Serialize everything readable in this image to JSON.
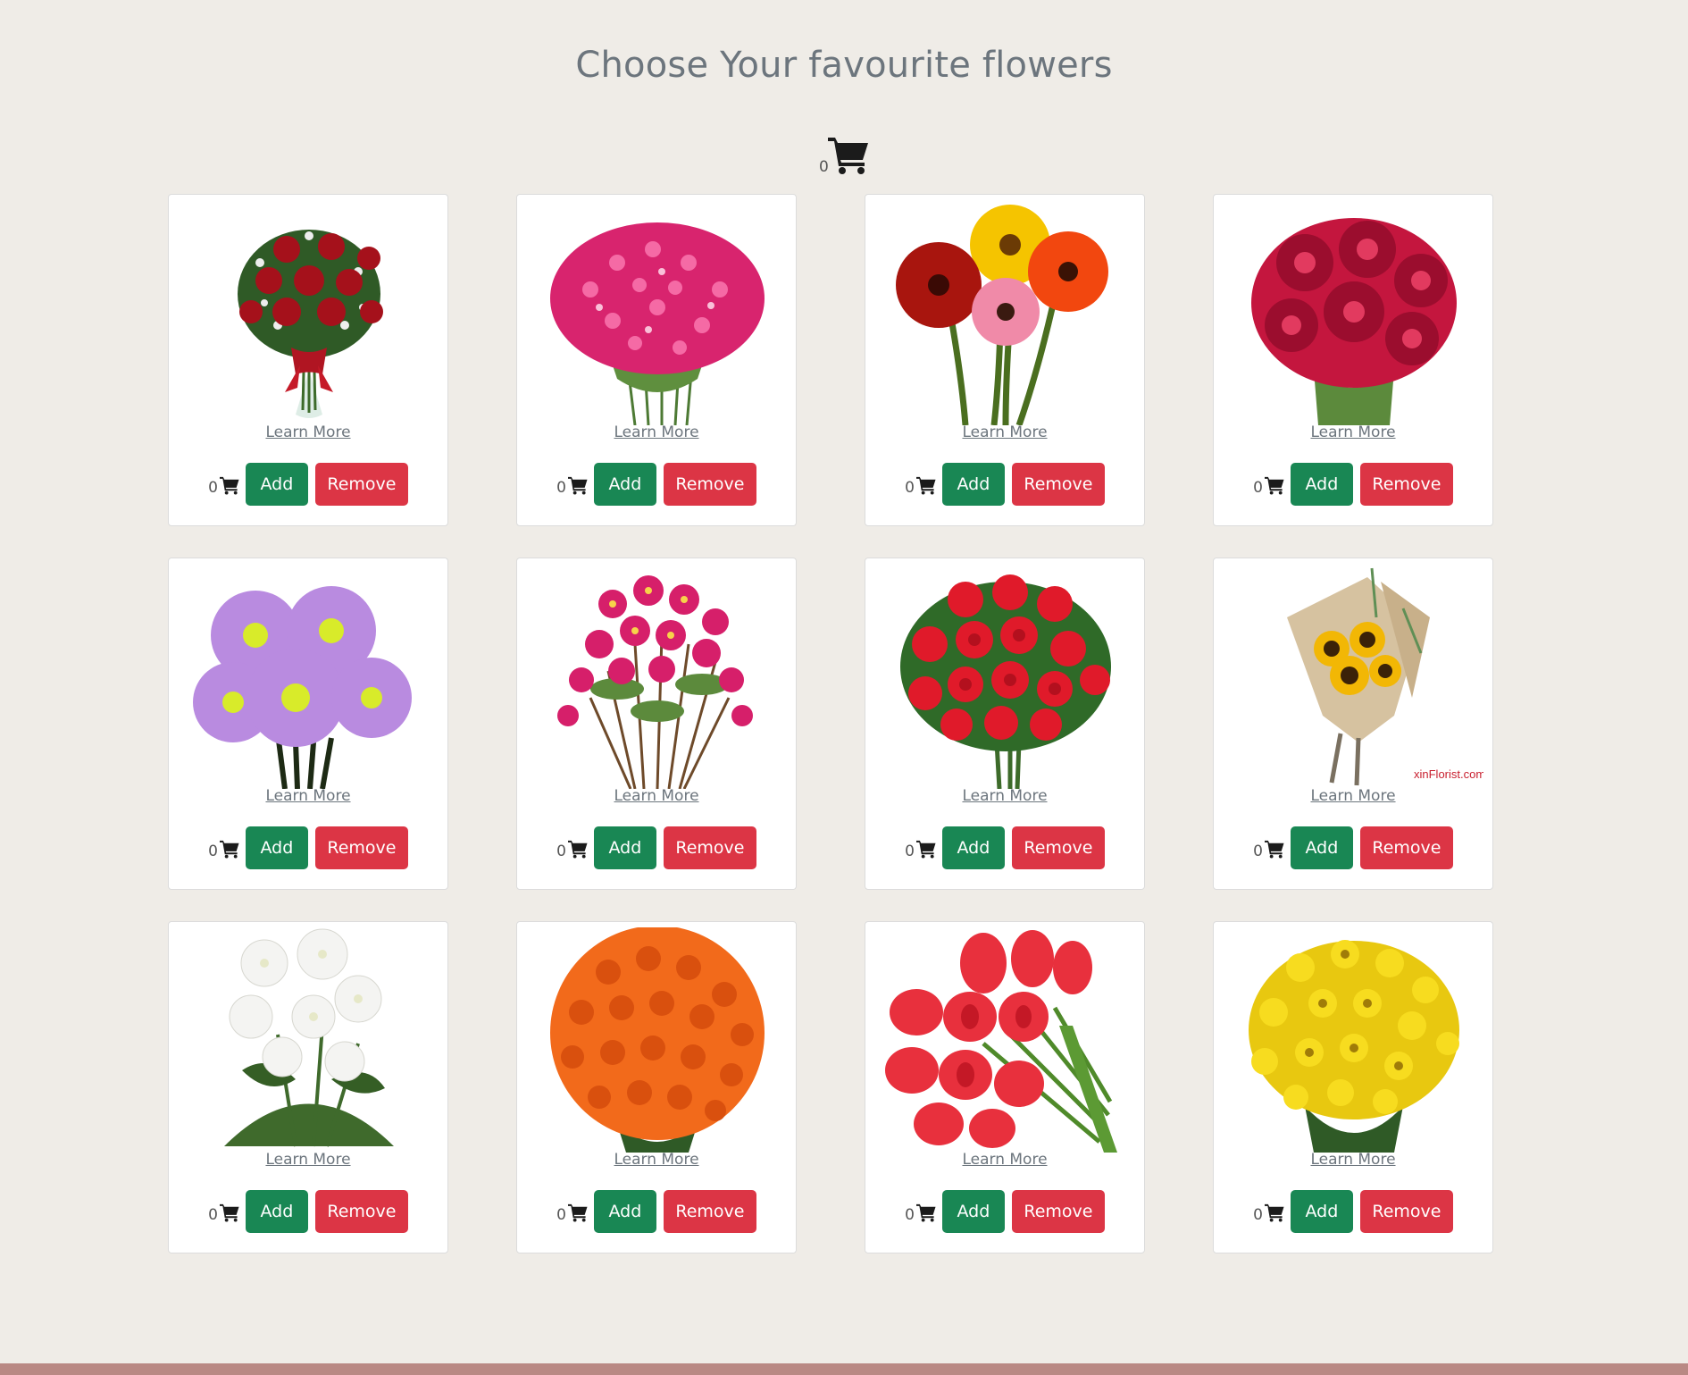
{
  "page": {
    "title": "Choose Your favourite flowers",
    "cart_count": "0",
    "cart_icon": "shopping-cart-icon"
  },
  "colors": {
    "background": "#efece7",
    "add_button": "#198754",
    "remove_button": "#dc3545",
    "footer": "#b98984"
  },
  "products": [
    {
      "image": "red-roses-bouquet",
      "learn_more": "Learn More",
      "count": "0",
      "add_label": "Add",
      "remove_label": "Remove"
    },
    {
      "image": "pink-dianthus-bunch",
      "learn_more": "Learn More",
      "count": "0",
      "add_label": "Add",
      "remove_label": "Remove"
    },
    {
      "image": "mixed-gerbera-daisies",
      "learn_more": "Learn More",
      "count": "0",
      "add_label": "Add",
      "remove_label": "Remove"
    },
    {
      "image": "red-chrysanthemums",
      "learn_more": "Learn More",
      "count": "0",
      "add_label": "Add",
      "remove_label": "Remove"
    },
    {
      "image": "purple-daisies",
      "learn_more": "Learn More",
      "count": "0",
      "add_label": "Add",
      "remove_label": "Remove"
    },
    {
      "image": "pink-asters",
      "learn_more": "Learn More",
      "count": "0",
      "add_label": "Add",
      "remove_label": "Remove"
    },
    {
      "image": "red-rose-bunch",
      "learn_more": "Learn More",
      "count": "0",
      "add_label": "Add",
      "remove_label": "Remove"
    },
    {
      "image": "sunflower-wrapped-bouquet",
      "learn_more": "Learn More",
      "count": "0",
      "add_label": "Add",
      "remove_label": "Remove",
      "watermark": "xinFlorist.com"
    },
    {
      "image": "white-chrysanthemums",
      "learn_more": "Learn More",
      "count": "0",
      "add_label": "Add",
      "remove_label": "Remove"
    },
    {
      "image": "orange-roses-ball",
      "learn_more": "Learn More",
      "count": "0",
      "add_label": "Add",
      "remove_label": "Remove"
    },
    {
      "image": "red-tulips",
      "learn_more": "Learn More",
      "count": "0",
      "add_label": "Add",
      "remove_label": "Remove"
    },
    {
      "image": "yellow-daisy-mums",
      "learn_more": "Learn More",
      "count": "0",
      "add_label": "Add",
      "remove_label": "Remove"
    }
  ]
}
